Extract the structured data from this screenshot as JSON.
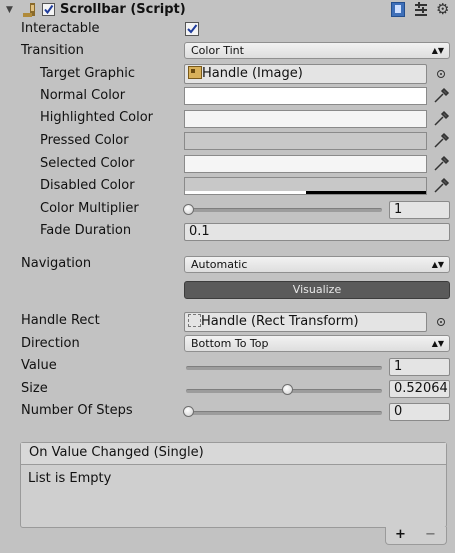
{
  "header": {
    "component_title": "Scrollbar (Script)",
    "enabled": true,
    "icons": [
      "foldout-arrow-icon",
      "scrollbar-component-icon",
      "help-book-icon",
      "preset-icon",
      "gear-icon"
    ]
  },
  "fields": {
    "interactable": {
      "label": "Interactable",
      "checked": true
    },
    "transition": {
      "label": "Transition",
      "value": "Color Tint"
    },
    "target_graphic": {
      "label": "Target Graphic",
      "value": "Handle (Image)"
    },
    "normal_color": {
      "label": "Normal Color",
      "color": "#ffffff"
    },
    "highlighted_color": {
      "label": "Highlighted Color",
      "color": "#f5f5f5"
    },
    "pressed_color": {
      "label": "Pressed Color",
      "color": "#c8c8c8"
    },
    "selected_color": {
      "label": "Selected Color",
      "color": "#f5f5f5"
    },
    "disabled_color": {
      "label": "Disabled Color",
      "color": "#c8c8c8",
      "alpha": 0.5
    },
    "color_multiplier": {
      "label": "Color Multiplier",
      "value": "1",
      "slider_fraction": 0.0
    },
    "fade_duration": {
      "label": "Fade Duration",
      "value": "0.1"
    },
    "navigation": {
      "label": "Navigation",
      "value": "Automatic"
    },
    "visualize": {
      "label": "Visualize"
    },
    "handle_rect": {
      "label": "Handle Rect",
      "value": "Handle (Rect Transform)"
    },
    "direction": {
      "label": "Direction",
      "value": "Bottom To Top"
    },
    "value": {
      "label": "Value",
      "value": "1",
      "slider_fraction": 1.0
    },
    "size": {
      "label": "Size",
      "value": "0.52064",
      "slider_fraction": 0.52064
    },
    "number_of_steps": {
      "label": "Number Of Steps",
      "value": "0",
      "slider_fraction": 0.0
    }
  },
  "event": {
    "title": "On Value Changed (Single)",
    "empty_text": "List is Empty",
    "add_label": "+",
    "remove_label": "−"
  },
  "colors": {
    "background": "#c2c2c2",
    "checkbox_blue": "#3a5fc8",
    "visualize_button": "#5a5a5a"
  }
}
